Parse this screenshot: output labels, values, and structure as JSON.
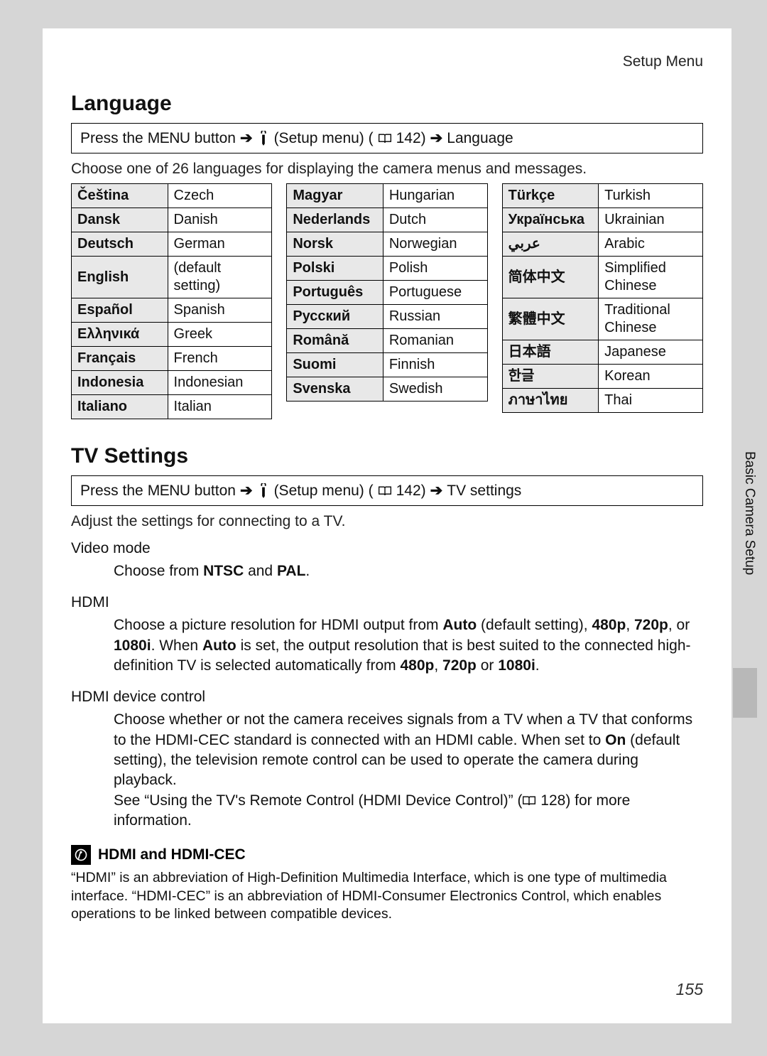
{
  "header": {
    "label": "Setup Menu"
  },
  "sidebar": {
    "section_label": "Basic Camera Setup"
  },
  "page_number": "155",
  "language_section": {
    "title": "Language",
    "nav": {
      "press": "Press the",
      "menu_word": "MENU",
      "button_word": "button",
      "setup_label": "(Setup menu) (",
      "page_ref": "142)",
      "dest": "Language"
    },
    "intro": "Choose one of 26 languages for displaying the camera menus and messages.",
    "columns": [
      [
        {
          "native": "Čeština",
          "english": "Czech"
        },
        {
          "native": "Dansk",
          "english": "Danish"
        },
        {
          "native": "Deutsch",
          "english": "German"
        },
        {
          "native": "English",
          "english": "(default setting)"
        },
        {
          "native": "Español",
          "english": "Spanish"
        },
        {
          "native": "Ελληνικά",
          "english": "Greek"
        },
        {
          "native": "Français",
          "english": "French"
        },
        {
          "native": "Indonesia",
          "english": "Indonesian"
        },
        {
          "native": "Italiano",
          "english": "Italian"
        }
      ],
      [
        {
          "native": "Magyar",
          "english": "Hungarian"
        },
        {
          "native": "Nederlands",
          "english": "Dutch"
        },
        {
          "native": "Norsk",
          "english": "Norwegian"
        },
        {
          "native": "Polski",
          "english": "Polish"
        },
        {
          "native": "Português",
          "english": "Portuguese"
        },
        {
          "native": "Русский",
          "english": "Russian"
        },
        {
          "native": "Română",
          "english": "Romanian"
        },
        {
          "native": "Suomi",
          "english": "Finnish"
        },
        {
          "native": "Svenska",
          "english": "Swedish"
        }
      ],
      [
        {
          "native": "Türkçe",
          "english": "Turkish"
        },
        {
          "native": "Українська",
          "english": "Ukrainian"
        },
        {
          "native": "عربي",
          "english": "Arabic"
        },
        {
          "native": "简体中文",
          "english": "Simplified Chinese"
        },
        {
          "native": "繁體中文",
          "english": "Traditional Chinese"
        },
        {
          "native": "日本語",
          "english": "Japanese"
        },
        {
          "native": "한글",
          "english": "Korean"
        },
        {
          "native": "ภาษาไทย",
          "english": "Thai"
        }
      ]
    ]
  },
  "tv_section": {
    "title": "TV Settings",
    "nav": {
      "press": "Press the",
      "menu_word": "MENU",
      "button_word": "button",
      "setup_label": "(Setup menu) (",
      "page_ref": "142)",
      "dest": "TV settings"
    },
    "intro": "Adjust the settings for connecting to a TV.",
    "settings": [
      {
        "name": "Video mode",
        "body_html": "Choose from <b>NTSC</b> and <b>PAL</b>."
      },
      {
        "name": "HDMI",
        "body_html": "Choose a picture resolution for HDMI output from <b>Auto</b> (default setting), <b>480p</b>, <b>720p</b>, or <b>1080i</b>. When <b>Auto</b> is set, the output resolution that is best suited to the connected high-definition TV is selected automatically from <b>480p</b>, <b>720p</b> or <b>1080i</b>."
      },
      {
        "name": "HDMI device control",
        "body_html": "Choose whether or not the camera receives signals from a TV when a TV that conforms to the HDMI-CEC standard is connected with an HDMI cable. When set to <b>On</b> (default setting), the television remote control can be used to operate the camera during playback.<br>See “Using the TV's Remote Control (HDMI Device Control)” (<svg style='width:20px;height:16px;vertical-align:-2px' viewBox='0 0 24 18'><path d='M2 2 h8 a2 2 0 0 1 2 2 v12 a2 2 0 0 0 -2 -2 h-8 z M22 2 h-8 a2 2 0 0 0 -2 2 v12 a2 2 0 0 1 2 -2 h8 z' fill='none' stroke='#000' stroke-width='1.6'/></svg> 128) for more information."
      }
    ],
    "note": {
      "title": "HDMI and HDMI-CEC",
      "body": "“HDMI” is an abbreviation of High-Definition Multimedia Interface, which is one type of multimedia interface. “HDMI-CEC” is an abbreviation of HDMI-Consumer Electronics Control, which enables operations to be linked between compatible devices."
    }
  }
}
